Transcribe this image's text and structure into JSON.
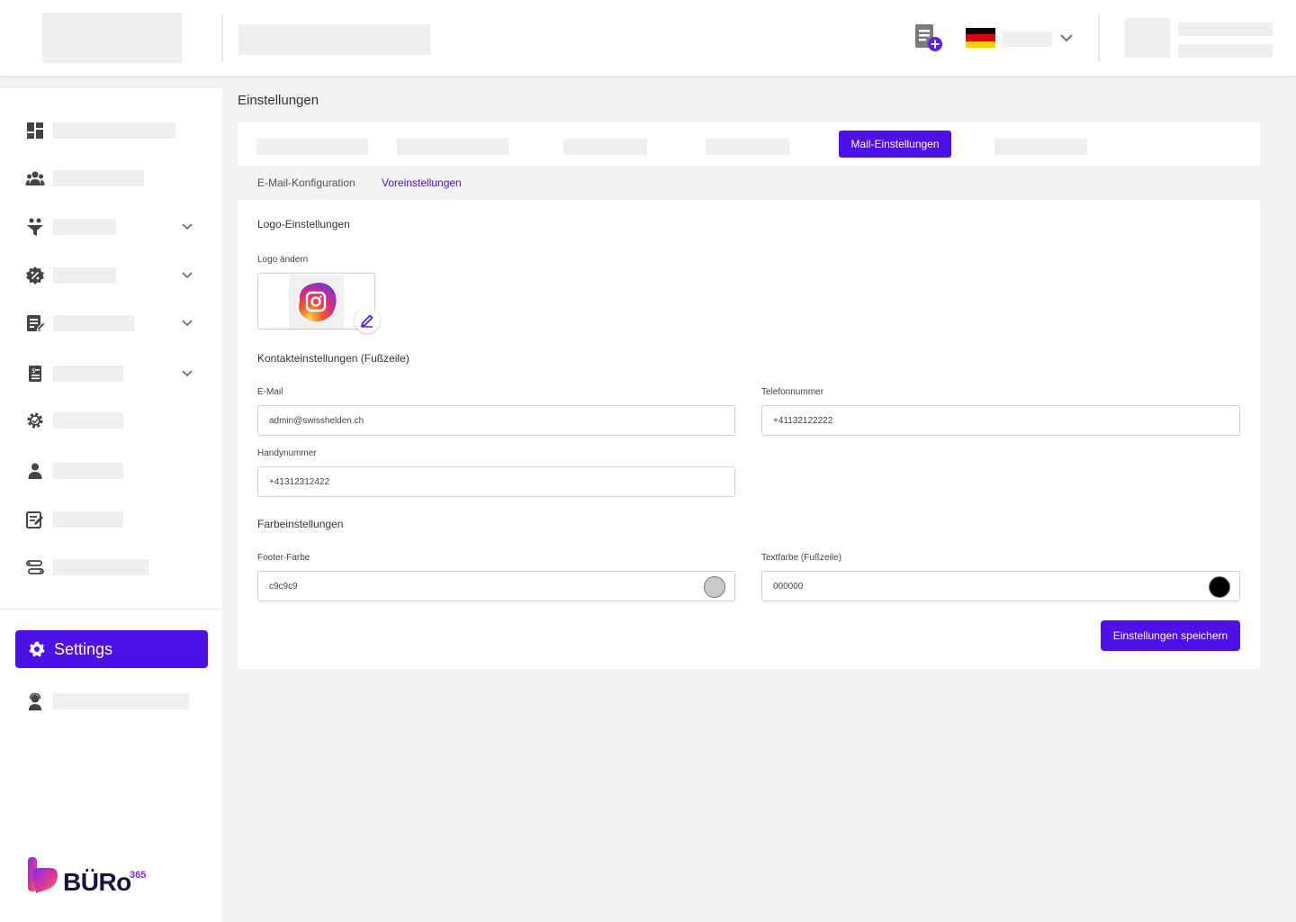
{
  "header": {
    "language_flag": "de",
    "icons": [
      "add-document-icon",
      "chevron-down-icon"
    ]
  },
  "sidebar": {
    "settings_label": "Settings",
    "brand": {
      "name": "BÜRo",
      "suffix": "365"
    }
  },
  "page": {
    "title": "Einstellungen",
    "active_tab": "Mail-Einstellungen",
    "subtabs": [
      "E-Mail-Konfiguration",
      "Voreinstellungen"
    ],
    "active_subtab": "Voreinstellungen"
  },
  "form": {
    "logo_section": "Logo-Einstellungen",
    "logo_label": "Logo ändern",
    "contact_section": "Kontakteinstellungen (Fußzeile)",
    "email_label": "E-Mail",
    "email_value": "admin@swisshelden.ch",
    "phone_label": "Telefonnummer",
    "phone_value": "+41132122222",
    "mobile_label": "Handynummer",
    "mobile_value": "+41312312422",
    "color_section": "Farbeinstellungen",
    "footer_color_label": "Footer-Farbe",
    "footer_color_value": "c9c9c9",
    "text_color_label": "Textfarbe (Fußzeile)",
    "text_color_value": "000000",
    "save_label": "Einstellungen speichern"
  },
  "colors": {
    "accent": "#4d10e9",
    "footer_swatch": "#c9c9c9",
    "text_swatch": "#000000"
  }
}
